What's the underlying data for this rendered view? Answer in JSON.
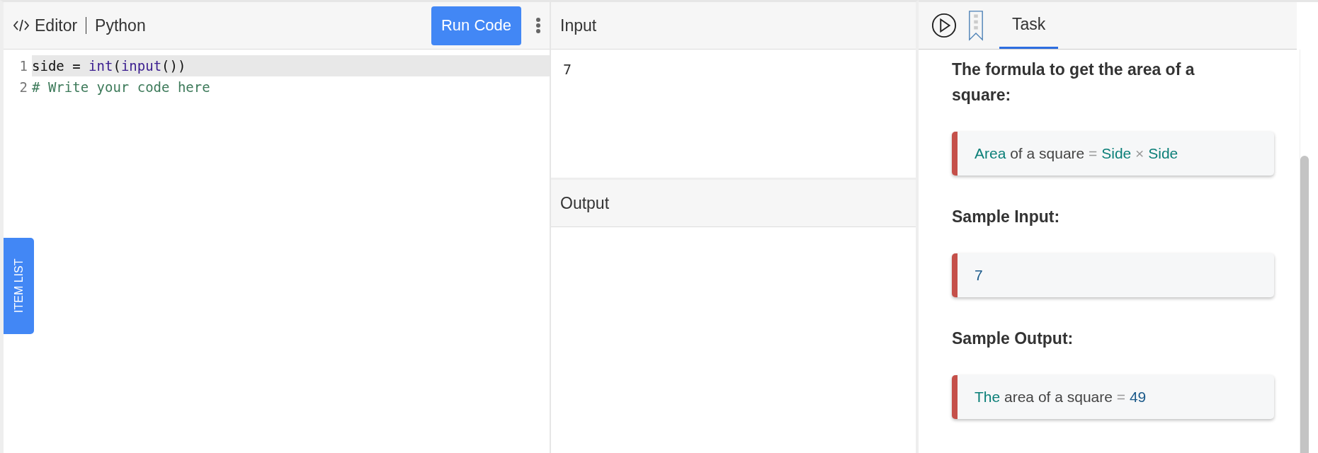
{
  "editor": {
    "title": "Editor",
    "language": "Python",
    "run_button": "Run Code",
    "lines": [
      {
        "number": "1",
        "active": true,
        "tokens": [
          {
            "kind": "name",
            "text": "side"
          },
          {
            "kind": "plain",
            "text": " = "
          },
          {
            "kind": "builtin",
            "text": "int"
          },
          {
            "kind": "plain",
            "text": "("
          },
          {
            "kind": "builtin",
            "text": "input"
          },
          {
            "kind": "plain",
            "text": "())"
          }
        ]
      },
      {
        "number": "2",
        "active": false,
        "tokens": [
          {
            "kind": "comment",
            "text": "# Write your code here"
          }
        ]
      }
    ],
    "side_tab": "ITEM LIST"
  },
  "input": {
    "title": "Input",
    "value": "7"
  },
  "output": {
    "title": "Output"
  },
  "task": {
    "tabs": [
      {
        "label": "Task",
        "selected": true
      }
    ],
    "blocks": [
      {
        "kind": "heading",
        "text": "The formula to get the area of a square:"
      },
      {
        "kind": "formula",
        "tokens": [
          {
            "kind": "term",
            "text": "Area"
          },
          {
            "kind": "text",
            "text": " of a square "
          },
          {
            "kind": "operator",
            "text": "= "
          },
          {
            "kind": "term",
            "text": "Side "
          },
          {
            "kind": "operator",
            "text": "× "
          },
          {
            "kind": "term",
            "text": "Side"
          }
        ]
      },
      {
        "kind": "heading",
        "text": "Sample Input:"
      },
      {
        "kind": "formula",
        "tokens": [
          {
            "kind": "number",
            "text": "7"
          }
        ]
      },
      {
        "kind": "heading",
        "text": "Sample Output:"
      },
      {
        "kind": "formula",
        "tokens": [
          {
            "kind": "term",
            "text": "The"
          },
          {
            "kind": "text",
            "text": " area of a square "
          },
          {
            "kind": "operator",
            "text": "= "
          },
          {
            "kind": "number",
            "text": "49"
          }
        ]
      }
    ]
  }
}
